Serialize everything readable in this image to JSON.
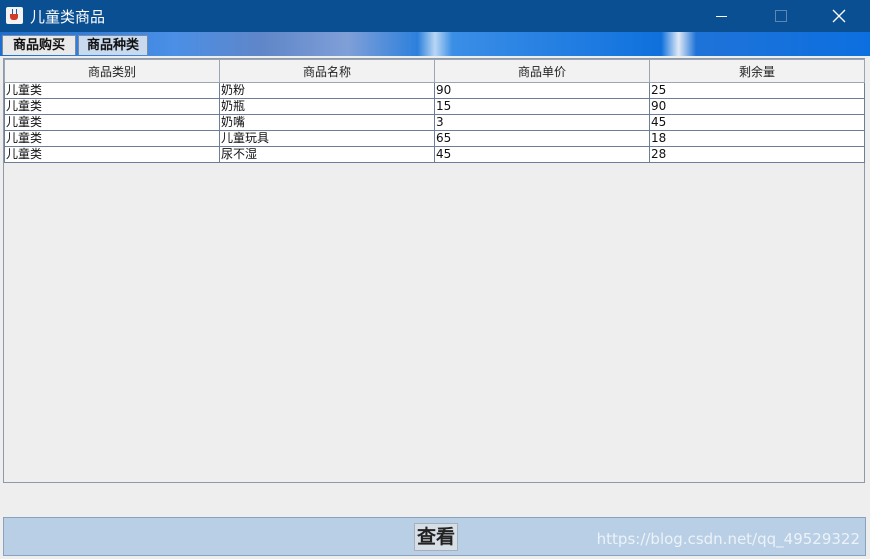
{
  "window": {
    "title": "儿童类商品",
    "icon": "java-cup-icon",
    "controls": [
      "minimize-icon",
      "maximize-icon",
      "close-icon"
    ]
  },
  "tabs": [
    {
      "label": "商品购买",
      "selected": false
    },
    {
      "label": "商品种类",
      "selected": true
    }
  ],
  "table": {
    "columns": [
      "商品类别",
      "商品名称",
      "商品单价",
      "剩余量"
    ],
    "rows": [
      [
        "儿童类",
        "奶粉",
        "90",
        "25"
      ],
      [
        "儿童类",
        "奶瓶",
        "15",
        "90"
      ],
      [
        "儿童类",
        "奶嘴",
        "3",
        "45"
      ],
      [
        "儿童类",
        "儿童玩具",
        "65",
        "18"
      ],
      [
        "儿童类",
        "尿不湿",
        "45",
        "28"
      ]
    ]
  },
  "actions": {
    "view_label": "查看"
  },
  "watermark": "https://blog.csdn.net/qq_49529322",
  "colors": {
    "titlebar": "#0b4f93",
    "selected_tab": "#c9d9ee",
    "bottom_bar": "#b8cfe6"
  }
}
